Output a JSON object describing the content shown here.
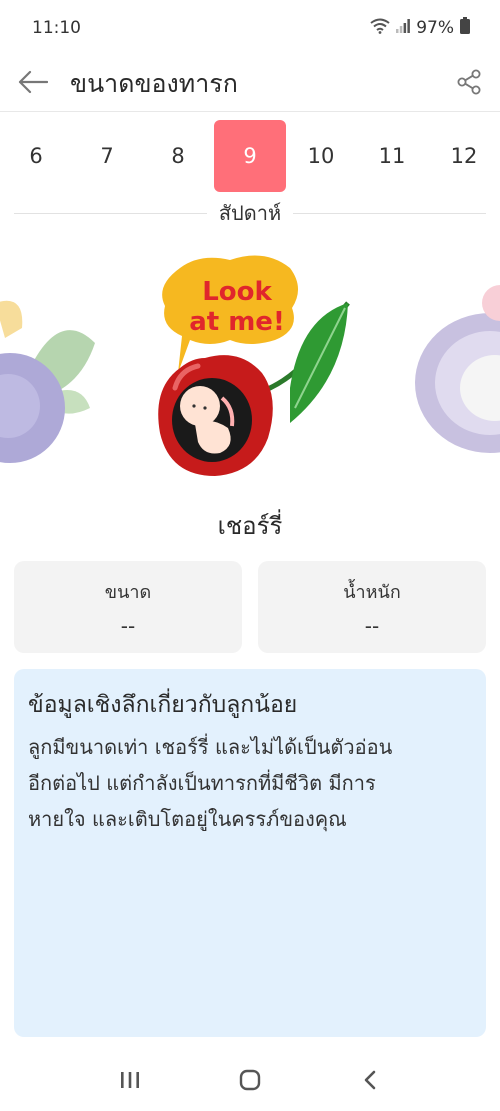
{
  "status_bar": {
    "time": "11:10",
    "battery": "97%"
  },
  "app_bar": {
    "title": "ขนาดของทารก"
  },
  "weeks": {
    "items": [
      "6",
      "7",
      "8",
      "9",
      "10",
      "11",
      "12"
    ],
    "selected": "9",
    "label": "สัปดาห์"
  },
  "illustration": {
    "bubble_line1": "Look",
    "bubble_line2": "at me!"
  },
  "fruit": {
    "name": "เชอร์รี่"
  },
  "stats": {
    "size_label": "ขนาด",
    "size_value": "--",
    "weight_label": "น้ำหนัก",
    "weight_value": "--"
  },
  "insight": {
    "title": "ข้อมูลเชิงลึกเกี่ยวกับลูกน้อย",
    "lines": [
      "ลูกมีขนาดเท่า เชอร์รี่ และไม่ได้เป็นตัวอ่อน",
      "อีกต่อไป แต่กำลังเป็นทารกที่มีชีวิต มีการ",
      "หายใจ และเติบโตอยู่ในครรภ์ของคุณ"
    ]
  },
  "colors": {
    "accent": "#ff6f79",
    "info_bg": "#e3f1fd",
    "card_bg": "#f3f3f3"
  }
}
